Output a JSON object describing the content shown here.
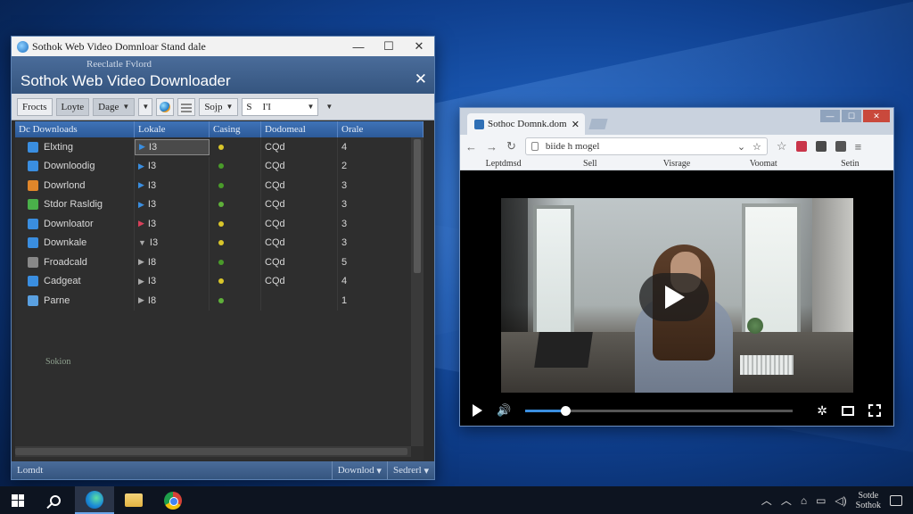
{
  "downloader": {
    "window_title": "Sothok Web Video Domnloar Stand dale",
    "header_subtitle": "Reeclatle Fvlord",
    "header_title": "Sothok Web Video Downloader",
    "toolbar": {
      "btn1": "Frocts",
      "btn2": "Loyte",
      "btn3": "Dage",
      "btn4": "Sojp",
      "search_a": "S",
      "search_b": "I'I"
    },
    "columns": [
      "Dc Downloads",
      "Lokale",
      "Casing",
      "Dodomeal",
      "Orale"
    ],
    "rows": [
      {
        "name": "Elxting",
        "icon_color": "#3a8ee0",
        "arrow": "▶",
        "arrow_color": "#3a8ee0",
        "lokale": "I3",
        "status_color": "#d9c62a",
        "dod": "CQd",
        "orale": "4"
      },
      {
        "name": "Downloodig",
        "icon_color": "#3a8ee0",
        "arrow": "▶",
        "arrow_color": "#3a8ee0",
        "lokale": "I3",
        "status_color": "#4a9b2a",
        "dod": "CQd",
        "orale": "2"
      },
      {
        "name": "Dowrlond",
        "icon_color": "#e0862a",
        "arrow": "▶",
        "arrow_color": "#3a8ee0",
        "lokale": "I3",
        "status_color": "#4a9b2a",
        "dod": "CQd",
        "orale": "3"
      },
      {
        "name": "Stdor Rasldig",
        "icon_color": "#4ab04a",
        "arrow": "▶",
        "arrow_color": "#3a8ee0",
        "lokale": "I3",
        "status_color": "#5fb03a",
        "dod": "CQd",
        "orale": "3"
      },
      {
        "name": "Downloator",
        "icon_color": "#3a8ee0",
        "arrow": "▶",
        "arrow_color": "#d9405a",
        "lokale": "I3",
        "status_color": "#d9c62a",
        "dod": "CQd",
        "orale": "3"
      },
      {
        "name": "Downkale",
        "icon_color": "#3a8ee0",
        "arrow": "▼",
        "arrow_color": "#aaaaaa",
        "lokale": "I3",
        "status_color": "#d9c62a",
        "dod": "CQd",
        "orale": "3"
      },
      {
        "name": "Froadcald",
        "icon_color": "#888888",
        "arrow": "▶",
        "arrow_color": "#aaaaaa",
        "lokale": "I8",
        "status_color": "#4a9b2a",
        "dod": "CQd",
        "orale": "5"
      },
      {
        "name": "Cadgeat",
        "icon_color": "#3a8ee0",
        "arrow": "▶",
        "arrow_color": "#aaaaaa",
        "lokale": "I3",
        "status_color": "#d9c62a",
        "dod": "CQd",
        "orale": "4"
      },
      {
        "name": "Parne",
        "icon_color": "#5aa0e0",
        "arrow": "▶",
        "arrow_color": "#aaaaaa",
        "lokale": "I8",
        "status_color": "#5fb03a",
        "dod": "",
        "orale": "1"
      }
    ],
    "row_sublabel": "Sokion",
    "status": {
      "left": "Lomdt",
      "mid": "Downlod",
      "right": "Sedrerl"
    }
  },
  "browser": {
    "tab_title": "Sothoc Domnk.dom",
    "address": "biide h mogel",
    "bookmarks": [
      "Leptdmsd",
      "Sell",
      "Visrage",
      "Voomat",
      "Setin"
    ],
    "video_progress": 0.15
  },
  "taskbar": {
    "clock_line1": "Sotde",
    "clock_line2": "Sothok"
  },
  "colors": {
    "accent": "#3f73b8",
    "desktop": "#0f3f8e"
  }
}
